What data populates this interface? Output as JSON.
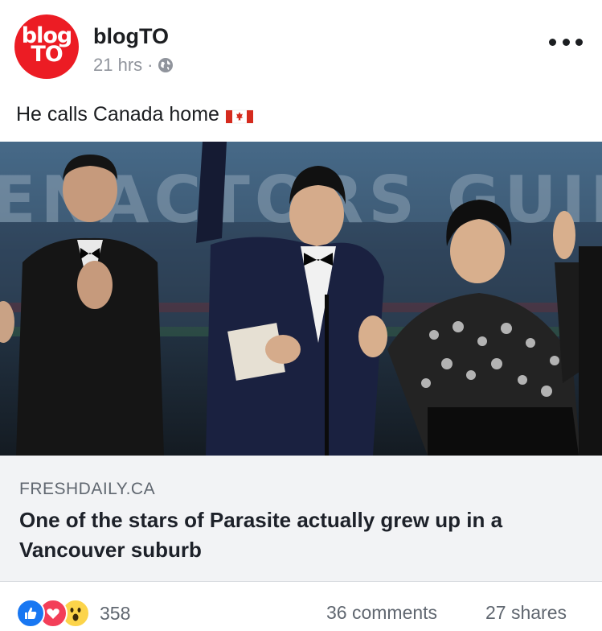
{
  "post": {
    "avatar_line1": "blog",
    "avatar_line2": "TO",
    "page_name": "blogTO",
    "time": "21 hrs",
    "separator": "·",
    "privacy_icon": "globe-icon",
    "more_icon": "more-dots-icon",
    "text": "He calls Canada home",
    "emoji": "canada-flag-icon"
  },
  "link": {
    "domain": "FRESHDAILY.CA",
    "title": "One of the stars of Parasite actually grew up in a Vancouver suburb"
  },
  "footer": {
    "reaction_icons": [
      "like-icon",
      "love-icon",
      "wow-icon"
    ],
    "reaction_count": "358",
    "comments": "36 comments",
    "shares": "27 shares"
  },
  "colors": {
    "brand_red": "#ec1c24",
    "like_blue": "#1877f2",
    "love_red": "#f33e58",
    "wow_yellow": "#fcd44a"
  }
}
